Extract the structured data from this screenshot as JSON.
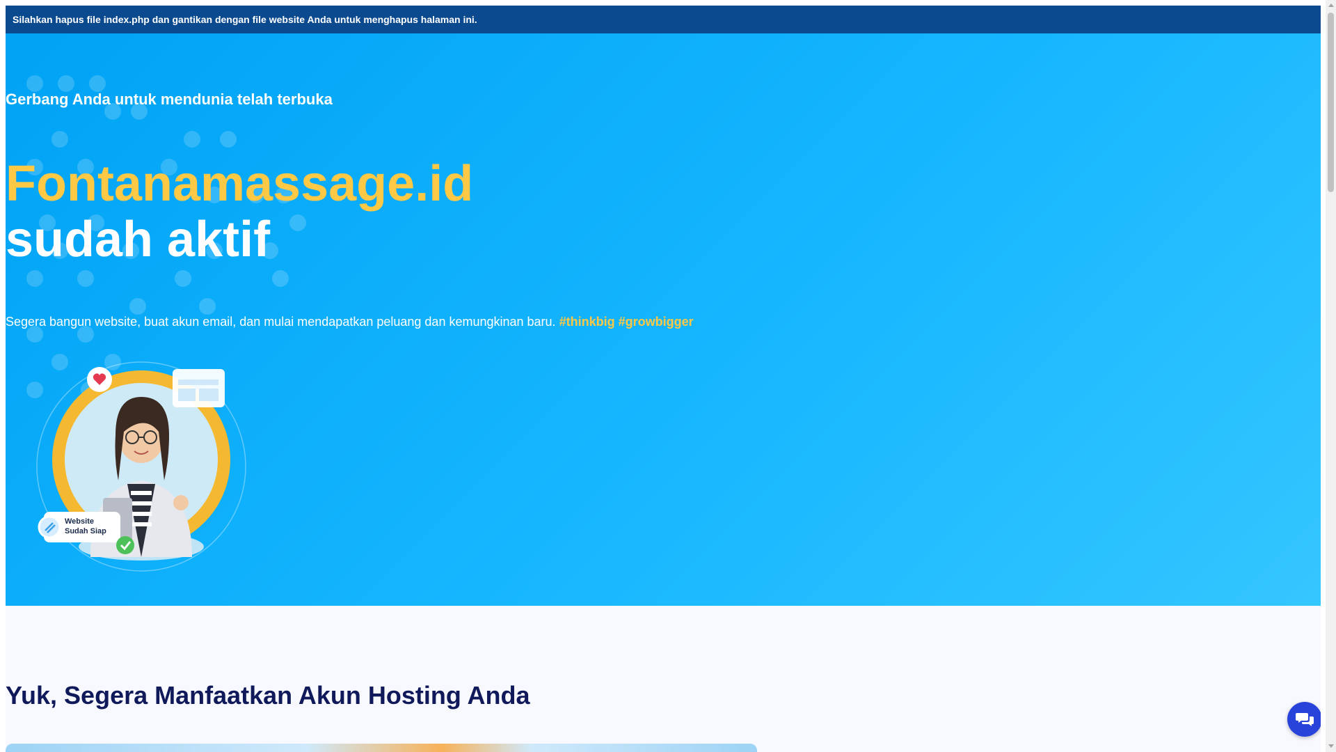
{
  "notice": {
    "text": "Silahkan hapus file index.php dan gantikan dengan file website Anda untuk menghapus halaman ini."
  },
  "hero": {
    "subtitle": "Gerbang Anda untuk mendunia telah terbuka",
    "domain": "Fontanamassage.id",
    "status": "sudah aktif",
    "description": "Segera bangun website, buat akun email, dan mulai mendapatkan peluang dan kemungkinan baru.",
    "hashtags": "#thinkbig #growbigger"
  },
  "illustration": {
    "badge_line1": "Website",
    "badge_line2": "Sudah Siap"
  },
  "section": {
    "title": "Yuk, Segera Manfaatkan Akun Hosting Anda"
  },
  "colors": {
    "accent_yellow": "#ffc845",
    "hero_blue": "#16b6ff",
    "chat_button": "#2743d9",
    "heading_navy": "#10195a"
  },
  "icons": {
    "chat": "chat-bubbles-icon",
    "heart": "heart-icon",
    "check": "check-icon",
    "brush": "brush-icon"
  }
}
